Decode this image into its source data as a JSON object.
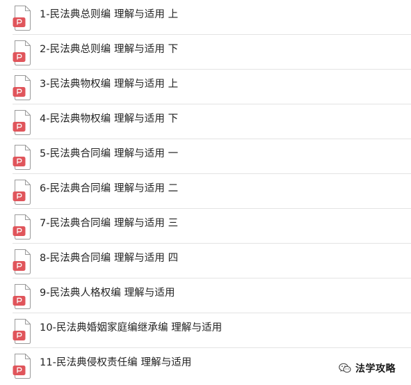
{
  "files": [
    {
      "name": "1-民法典总则编 理解与适用 上",
      "icon": "pdf-file-icon"
    },
    {
      "name": "2-民法典总则编 理解与适用 下",
      "icon": "pdf-file-icon"
    },
    {
      "name": "3-民法典物权编 理解与适用 上",
      "icon": "pdf-file-icon"
    },
    {
      "name": "4-民法典物权编 理解与适用 下",
      "icon": "pdf-file-icon"
    },
    {
      "name": "5-民法典合同编 理解与适用 一",
      "icon": "pdf-file-icon"
    },
    {
      "name": "6-民法典合同编 理解与适用 二",
      "icon": "pdf-file-icon"
    },
    {
      "name": "7-民法典合同编 理解与适用 三",
      "icon": "pdf-file-icon"
    },
    {
      "name": "8-民法典合同编 理解与适用 四",
      "icon": "pdf-file-icon"
    },
    {
      "name": "9-民法典人格权编 理解与适用",
      "icon": "pdf-file-icon"
    },
    {
      "name": "10-民法典婚姻家庭编继承编 理解与适用",
      "icon": "pdf-file-icon"
    },
    {
      "name": "11-民法典侵权责任编 理解与适用",
      "icon": "pdf-file-icon"
    }
  ],
  "watermark": {
    "text": "法学攻略",
    "icon": "wechat-icon"
  },
  "colors": {
    "pdf_badge": "#e0555b",
    "page_outline": "#9a9a9a",
    "divider": "#e3e3e3",
    "text": "#222222"
  }
}
